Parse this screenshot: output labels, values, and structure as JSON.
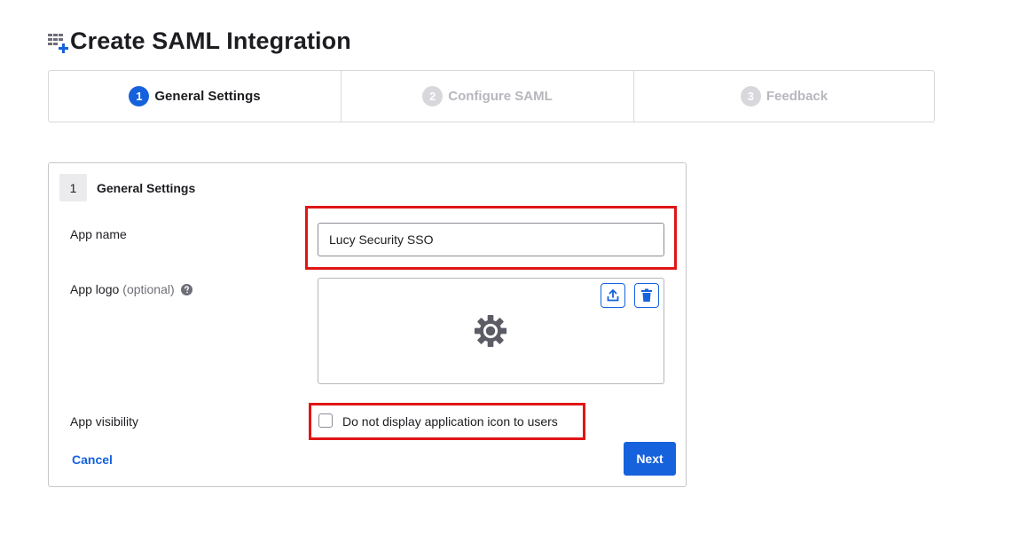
{
  "page": {
    "title": "Create SAML Integration",
    "title_icon": "app-grid-add-icon"
  },
  "stepper": {
    "steps": [
      {
        "number": "1",
        "label": "General Settings",
        "state": "active"
      },
      {
        "number": "2",
        "label": "Configure SAML",
        "state": "inactive"
      },
      {
        "number": "3",
        "label": "Feedback",
        "state": "inactive"
      }
    ]
  },
  "section": {
    "number": "1",
    "title": "General Settings"
  },
  "form": {
    "app_name": {
      "label": "App name",
      "value": "Lucy Security SSO"
    },
    "app_logo": {
      "label": "App logo",
      "optional": "(optional)",
      "help_icon": "question-circle-icon",
      "upload_icon": "upload-icon",
      "delete_icon": "trash-icon",
      "placeholder_icon": "gear-icon"
    },
    "app_visibility": {
      "label": "App visibility",
      "checkbox_label": "Do not display application icon to users",
      "checked": false
    }
  },
  "actions": {
    "cancel_label": "Cancel",
    "next_label": "Next"
  },
  "colors": {
    "primary": "#1662dd",
    "highlight": "#e01616",
    "inactive_step": "#b7b7bd"
  }
}
